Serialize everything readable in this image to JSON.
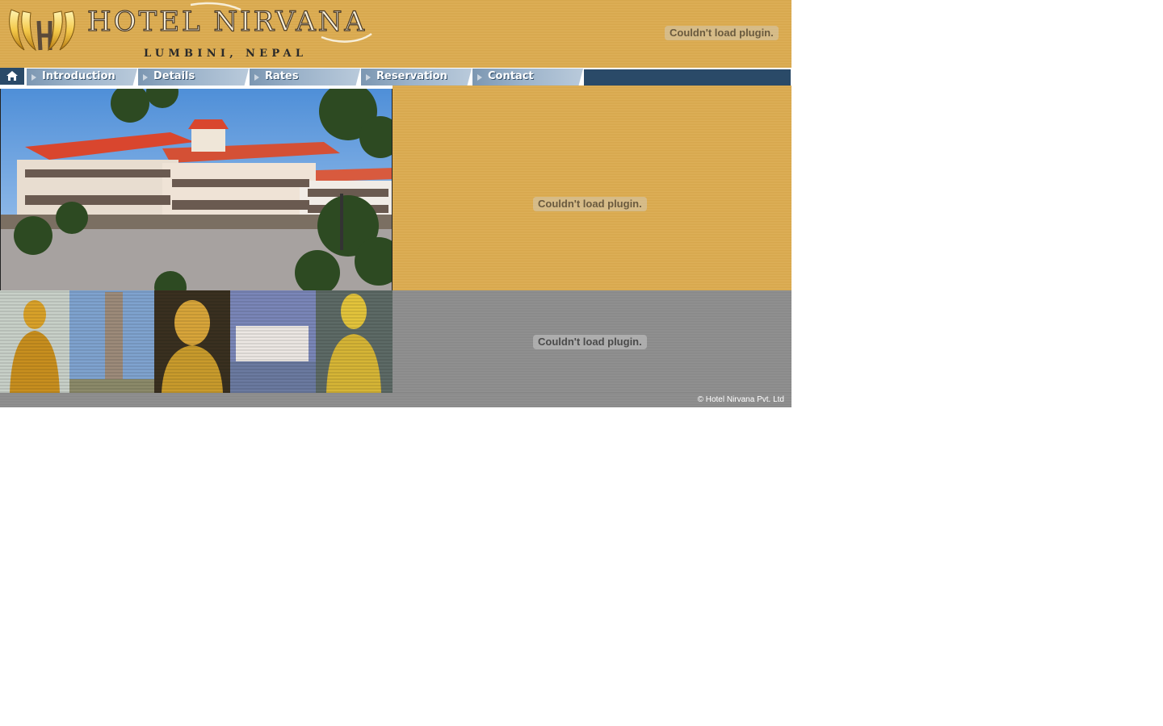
{
  "header": {
    "brand_title": "HOTEL NIRVANA",
    "brand_subtitle": "LUMBINI, NEPAL",
    "plugin_message": "Couldn't load plugin."
  },
  "nav": {
    "home_icon": "home-icon",
    "items": [
      {
        "label": "Introduction"
      },
      {
        "label": "Details"
      },
      {
        "label": "Rates"
      },
      {
        "label": "Reservation"
      },
      {
        "label": "Contact"
      }
    ]
  },
  "main": {
    "plugin_message_top": "Couldn't load plugin.",
    "plugin_message_bottom": "Couldn't load plugin."
  },
  "footer": {
    "copyright": "© Hotel Nirvana Pvt. Ltd"
  },
  "colors": {
    "gold": "#ddab4d",
    "grey": "#8c8c8c",
    "nav_dark": "#2a4a68",
    "nav_button": "#9cb3ca"
  }
}
